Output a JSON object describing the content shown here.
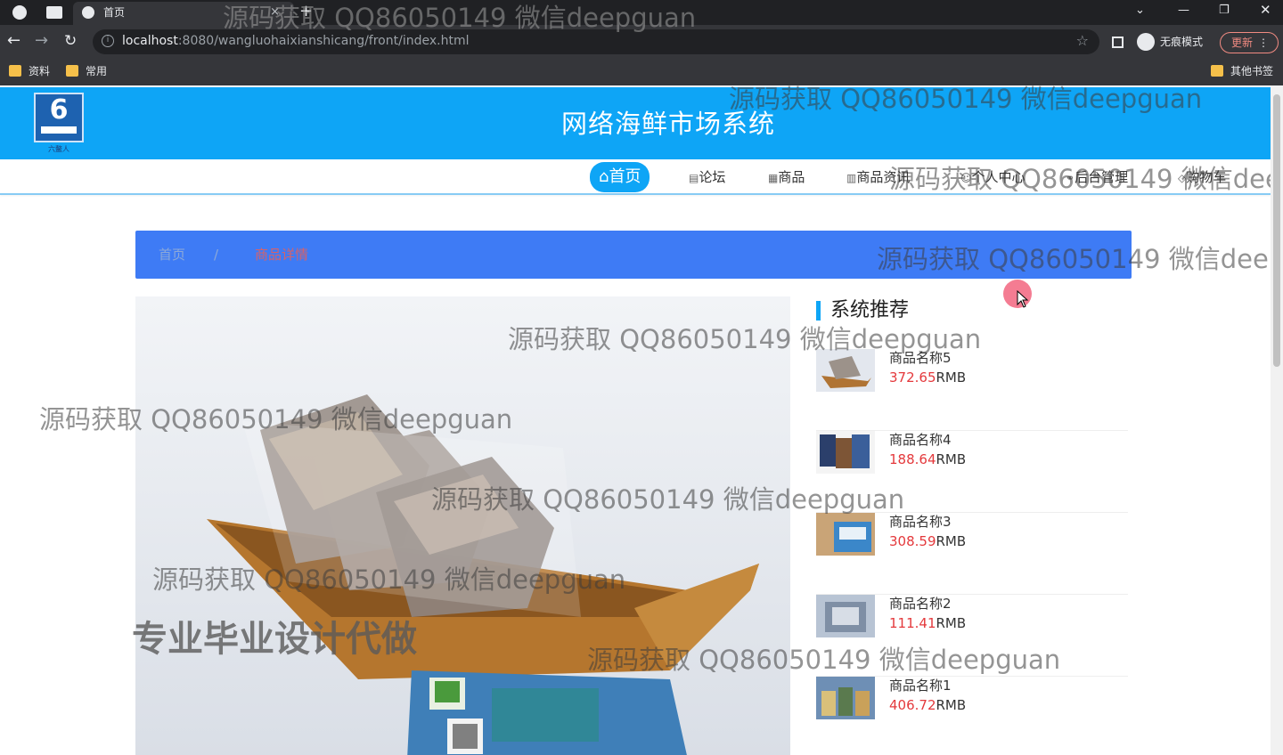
{
  "browser": {
    "tab_title": "首页",
    "tab_close": "×",
    "new_tab": "+",
    "url_host": "localhost",
    "url_rest": ":8080/wangluohaixianshicang/front/index.html",
    "incognito_label": "无痕模式",
    "update_label": "更新",
    "bookmarks": [
      "资料",
      "常用"
    ],
    "other_bookmarks": "其他书签"
  },
  "site": {
    "title": "网络海鲜市场系统",
    "logo_sub": "六鳌人"
  },
  "nav": {
    "items": [
      {
        "icon": "⌂",
        "label": "首页"
      },
      {
        "icon": "▤",
        "label": "论坛"
      },
      {
        "icon": "▦",
        "label": "商品"
      },
      {
        "icon": "▥",
        "label": "商品资讯"
      },
      {
        "icon": "☺",
        "label": "个人中心"
      },
      {
        "icon": "⚭",
        "label": "后台管理"
      },
      {
        "icon": "◇",
        "label": "购物车"
      }
    ]
  },
  "breadcrumb": {
    "home": "首页",
    "separator": "/",
    "current": "商品详情"
  },
  "recommend": {
    "title": "系统推荐",
    "currency": "RMB",
    "items": [
      {
        "name": "商品名称5",
        "price": "372.65"
      },
      {
        "name": "商品名称4",
        "price": "188.64"
      },
      {
        "name": "商品名称3",
        "price": "308.59"
      },
      {
        "name": "商品名称2",
        "price": "111.41"
      },
      {
        "name": "商品名称1",
        "price": "406.72"
      }
    ]
  },
  "overlay": {
    "watermark": "源码获取 QQ86050149 微信deepguan",
    "promo": "专业毕业设计代做"
  },
  "colors": {
    "header": "#0ea5f6",
    "breadcrumb": "#3e7bf5",
    "price": "#e4393c"
  }
}
